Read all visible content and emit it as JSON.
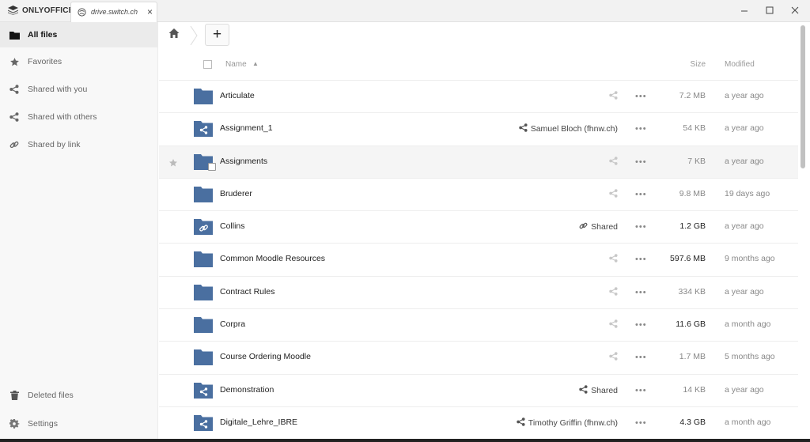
{
  "app": {
    "brand": "ONLYOFFICE",
    "tab_label": "drive.switch.ch",
    "tab_close": "×"
  },
  "sidebar": {
    "items": [
      {
        "label": "All files",
        "icon": "folder-icon",
        "active": true
      },
      {
        "label": "Favorites",
        "icon": "star-icon"
      },
      {
        "label": "Shared with you",
        "icon": "share-icon"
      },
      {
        "label": "Shared with others",
        "icon": "share-icon"
      },
      {
        "label": "Shared by link",
        "icon": "link-icon"
      }
    ],
    "bottom": [
      {
        "label": "Deleted files",
        "icon": "trash-icon"
      },
      {
        "label": "Settings",
        "icon": "gear-icon"
      }
    ]
  },
  "toolbar": {
    "new_label": "+"
  },
  "table": {
    "headers": {
      "name": "Name",
      "sort_indicator": "▲",
      "size": "Size",
      "modified": "Modified"
    },
    "rows": [
      {
        "name": "Articulate",
        "icon": "folder-icon",
        "share": "",
        "size": "7.2 MB",
        "modified": "a year ago"
      },
      {
        "name": "Assignment_1",
        "icon": "folder-shared-icon",
        "share": "Samuel Bloch (fhnw.ch)",
        "size": "54 KB",
        "modified": "a year ago"
      },
      {
        "name": "Assignments",
        "icon": "folder-icon",
        "share": "",
        "size": "7 KB",
        "modified": "a year ago",
        "hover": true
      },
      {
        "name": "Bruderer",
        "icon": "folder-icon",
        "share": "",
        "size": "9.8 MB",
        "modified": "19 days ago"
      },
      {
        "name": "Collins",
        "icon": "folder-link-icon",
        "share": "Shared",
        "share_type": "link",
        "size": "1.2 GB",
        "modified": "a year ago"
      },
      {
        "name": "Common Moodle Resources",
        "icon": "folder-icon",
        "share": "",
        "size": "597.6 MB",
        "modified": "9 months ago"
      },
      {
        "name": "Contract Rules",
        "icon": "folder-icon",
        "share": "",
        "size": "334 KB",
        "modified": "a year ago"
      },
      {
        "name": "Corpra",
        "icon": "folder-icon",
        "share": "",
        "size": "11.6 GB",
        "modified": "a month ago"
      },
      {
        "name": "Course Ordering Moodle",
        "icon": "folder-icon",
        "share": "",
        "size": "1.7 MB",
        "modified": "5 months ago"
      },
      {
        "name": "Demonstration",
        "icon": "folder-shared-icon",
        "share": "Shared",
        "share_type": "share",
        "size": "14 KB",
        "modified": "a year ago"
      },
      {
        "name": "Digitale_Lehre_IBRE",
        "icon": "folder-shared-icon",
        "share": "Timothy Griffin (fhnw.ch)",
        "size": "4.3 GB",
        "modified": "a month ago"
      }
    ]
  },
  "colors": {
    "folder": "#4a6fa0",
    "size_dark": "#222222",
    "size_light": "#888888"
  }
}
